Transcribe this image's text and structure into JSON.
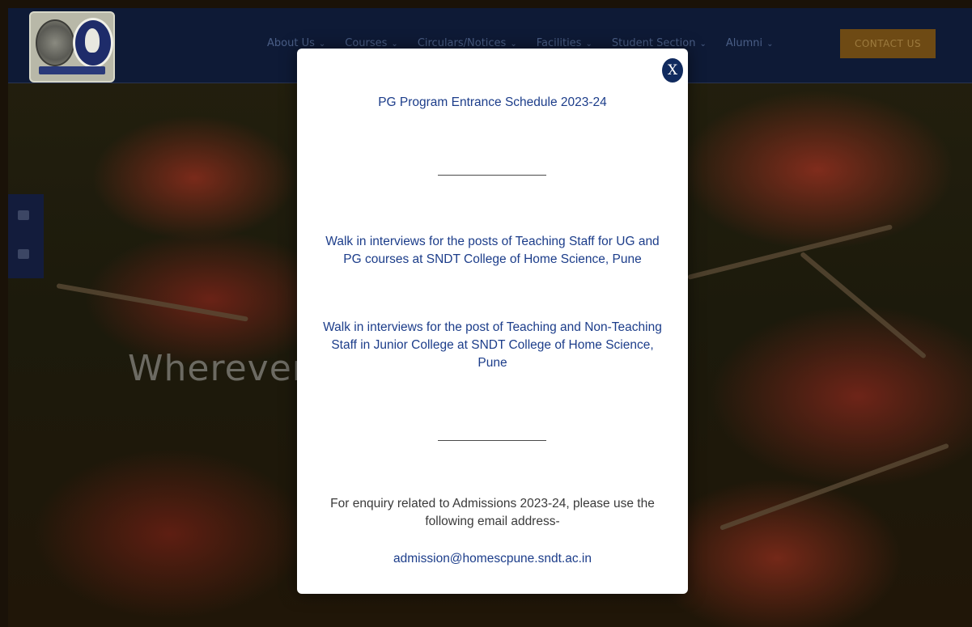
{
  "nav": {
    "items": [
      "About Us",
      "Courses",
      "Circulars/Notices",
      "Facilities",
      "Student Section",
      "Alumni"
    ],
    "contact_label": "CONTACT US"
  },
  "hero": {
    "text": "Wherever"
  },
  "modal": {
    "close_label": "X",
    "link1": "PG Program Entrance Schedule 2023-24",
    "link2_line1": "Walk in interviews for the posts of Teaching Staff for UG and",
    "link2_line2": "PG courses at SNDT College of Home Science, Pune",
    "link3_line1": "Walk in interviews for the post of Teaching and Non-Teaching",
    "link3_line2": "Staff in Junior College at SNDT College of Home Science,",
    "link3_line3": "Pune",
    "enquiry_line1": "For enquiry related to Admissions 2023-24, please use the",
    "enquiry_line2": "following email address-",
    "email": "admission@homescpune.sndt.ac.in"
  },
  "colors": {
    "link": "#1c3d8a",
    "topbar": "#0e1a36",
    "contact_button": "#6e4a14"
  },
  "icons": {
    "social": [
      "youtube-icon",
      "facebook-icon"
    ],
    "nav_caret": "chevron-down-icon"
  }
}
